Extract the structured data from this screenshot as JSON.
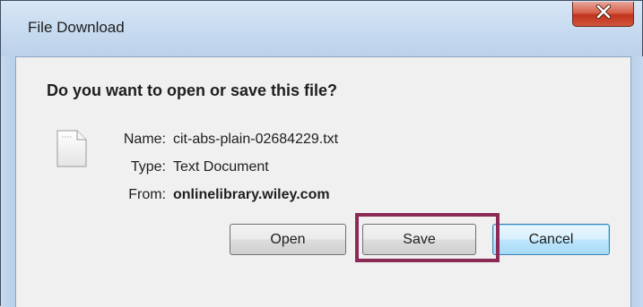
{
  "dialog": {
    "title": "File Download",
    "close_icon": "close-x-icon"
  },
  "question": "Do you want to open or save this file?",
  "file": {
    "icon": "text-document-icon",
    "name_label": "Name:",
    "name_value": "cit-abs-plain-02684229.txt",
    "type_label": "Type:",
    "type_value": "Text Document",
    "from_label": "From:",
    "from_value": "onlinelibrary.wiley.com"
  },
  "buttons": {
    "open": "Open",
    "save": "Save",
    "cancel": "Cancel"
  },
  "colors": {
    "highlight": "#8a2a55",
    "close_button": "#c2331b",
    "default_button_border": "#3c7fb1"
  }
}
